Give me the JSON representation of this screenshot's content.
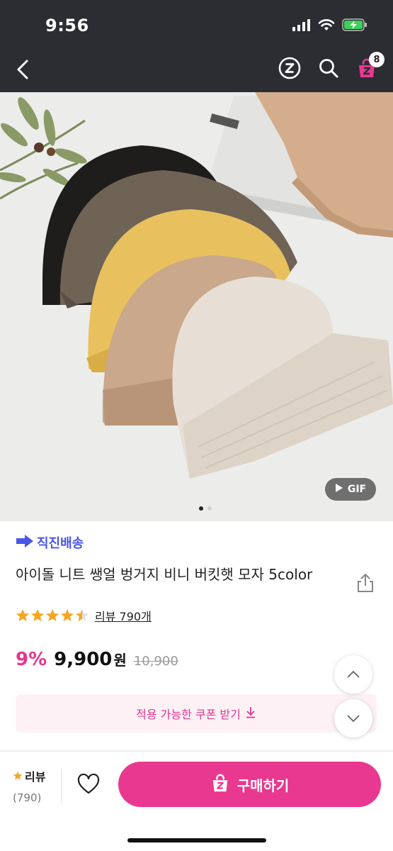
{
  "status_bar": {
    "time": "9:56"
  },
  "nav": {
    "cart_count": "8"
  },
  "hero": {
    "gif_label": "GIF",
    "page_dots": 2,
    "active_dot": 0
  },
  "product": {
    "shipping_badge": "직진배송",
    "title": "아이돌 니트 쌩얼 벙거지 비니 버킷햇 모자 5color",
    "rating_stars": 4.5,
    "review_link": "리뷰 790개",
    "discount": "9%",
    "price": "9,900",
    "price_unit": "원",
    "original_price": "10,900",
    "coupon_label": "적용 가능한 쿠폰 받기"
  },
  "bottom_bar": {
    "review_label": "리뷰",
    "review_count": "(790)",
    "buy_label": "구매하기"
  },
  "colors": {
    "accent_pink": "#e9388f",
    "ship_blue": "#4a55e8",
    "star": "#f5a623"
  }
}
